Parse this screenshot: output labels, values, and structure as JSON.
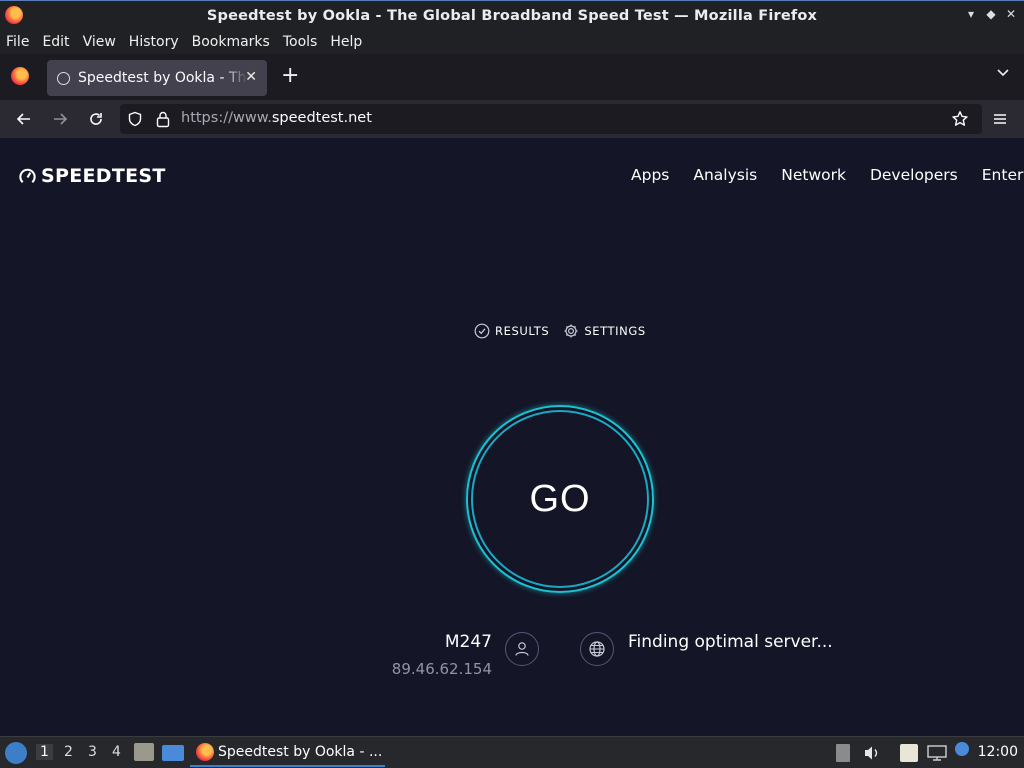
{
  "window": {
    "title": "Speedtest by Ookla - The Global Broadband Speed Test — Mozilla Firefox",
    "controls": [
      "minimize-icon",
      "maximize-icon",
      "close-icon"
    ]
  },
  "menubar": {
    "items": [
      "File",
      "Edit",
      "View",
      "History",
      "Bookmarks",
      "Tools",
      "Help"
    ]
  },
  "tabs": [
    {
      "title": "Speedtest by Ookla - The Global Broadband Speed Test",
      "active": true
    }
  ],
  "navbar": {
    "url_protocol": "https://www.",
    "url_host": "speedtest.net"
  },
  "site": {
    "logo_text": "SPEEDTEST",
    "nav": [
      "Apps",
      "Analysis",
      "Network",
      "Developers",
      "Enter"
    ],
    "subnav": {
      "results_label": "RESULTS",
      "settings_label": "SETTINGS"
    },
    "go_label": "GO",
    "isp_name": "M247",
    "isp_ip": "89.46.62.154",
    "server_status": "Finding optimal server..."
  },
  "taskbar": {
    "workspaces": [
      "1",
      "2",
      "3",
      "4"
    ],
    "active_workspace": "1",
    "task_label": "Speedtest by Ookla - ...",
    "clock": "12:00"
  },
  "colors": {
    "page_bg": "#141526",
    "ring": "#1ac3d2",
    "chrome_dark": "#1c1b22",
    "toolbar": "#2b2a33"
  }
}
